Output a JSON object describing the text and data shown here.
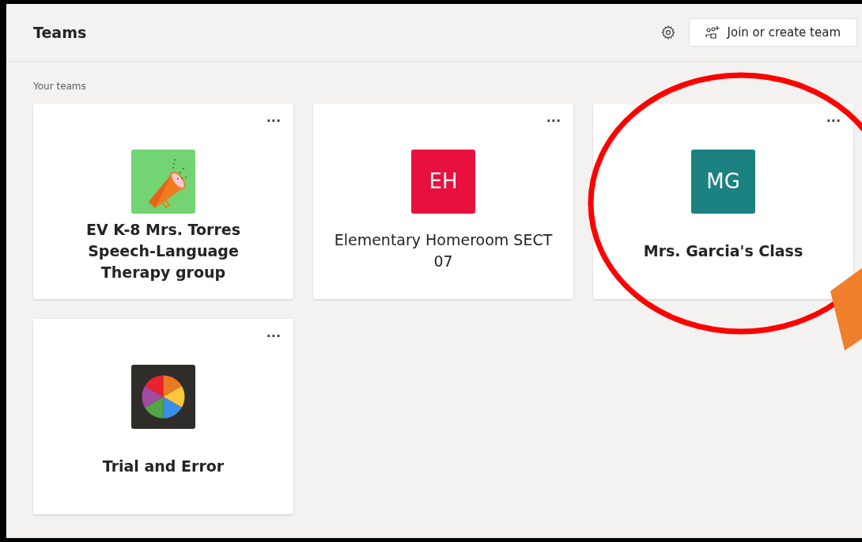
{
  "header": {
    "title": "Teams",
    "button": "Join or create team"
  },
  "section_label": "Your teams",
  "teams": [
    {
      "name": "EV K-8 Mrs. Torres Speech-Language Therapy group",
      "unread": true,
      "avatar": {
        "kind": "megaphone"
      }
    },
    {
      "name": "Elementary Homeroom SECT 07",
      "unread": false,
      "avatar": {
        "kind": "initials",
        "text": "EH",
        "color": "#e8113e"
      }
    },
    {
      "name": "Mrs. Garcia's Class",
      "unread": true,
      "avatar": {
        "kind": "initials",
        "text": "MG",
        "color": "#1b8181"
      }
    },
    {
      "name": "Trial and Error",
      "unread": true,
      "avatar": {
        "kind": "palette"
      }
    }
  ],
  "more_label": "···"
}
